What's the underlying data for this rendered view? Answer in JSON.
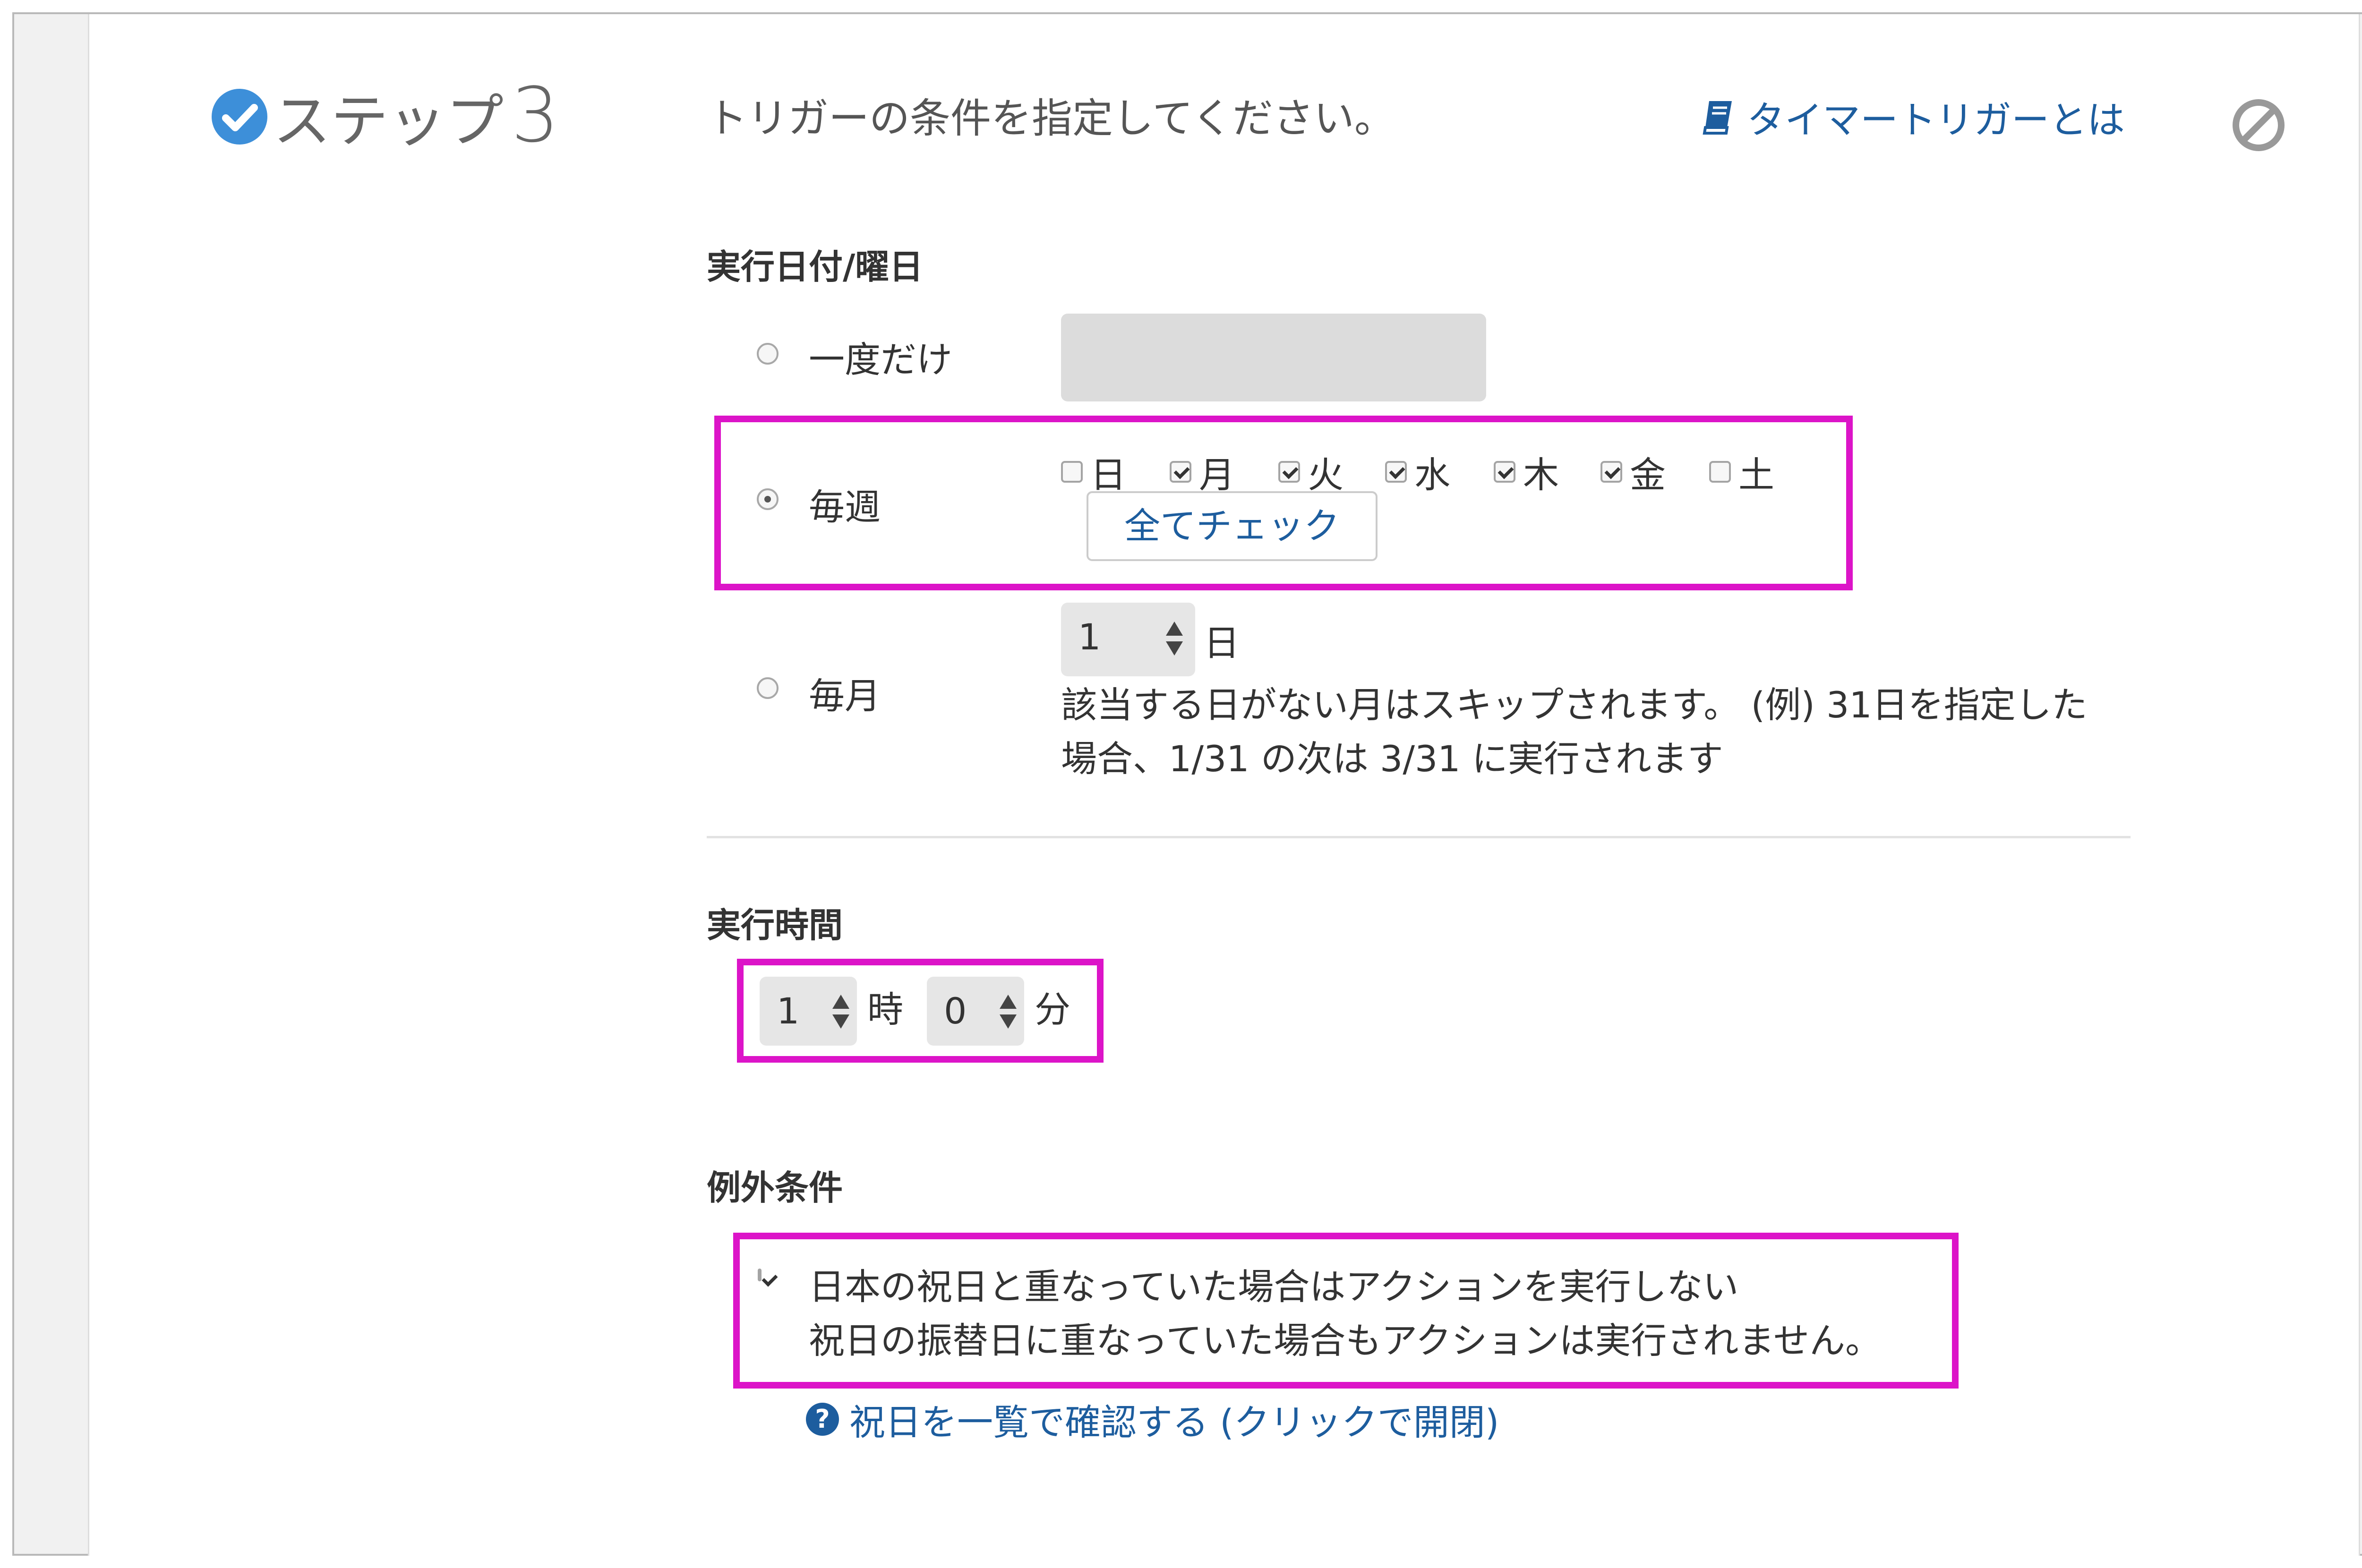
{
  "header": {
    "step_label": "ステップ",
    "step_number": "3",
    "instruction": "トリガーの条件を指定してください。",
    "help_link": "タイマートリガーとは",
    "icons": {
      "step_status": "check-circle-icon",
      "help": "book-icon",
      "disable": "disable-icon"
    }
  },
  "schedule": {
    "title": "実行日付/曜日",
    "once_label": "一度だけ",
    "weekly_label": "毎週",
    "monthly_label": "毎月",
    "selected": "毎週",
    "days": [
      {
        "label": "日",
        "checked": false
      },
      {
        "label": "月",
        "checked": true
      },
      {
        "label": "火",
        "checked": true
      },
      {
        "label": "水",
        "checked": true
      },
      {
        "label": "木",
        "checked": true
      },
      {
        "label": "金",
        "checked": true
      },
      {
        "label": "土",
        "checked": false
      }
    ],
    "check_all_button": "全てチェック",
    "monthly_day_value": "1",
    "monthly_day_unit": "日",
    "monthly_note_line1": "該当する日がない月はスキップされます。 (例) 31日を指定した",
    "monthly_note_line2": "場合、1/31 の次は 3/31 に実行されます"
  },
  "time": {
    "title": "実行時間",
    "hour_value": "1",
    "hour_unit": "時",
    "minute_value": "0",
    "minute_unit": "分"
  },
  "exception": {
    "title": "例外条件",
    "checked": true,
    "line1": "日本の祝日と重なっていた場合はアクションを実行しない",
    "line2": "祝日の振替日に重なっていた場合もアクションは実行されません。",
    "holiday_link": "祝日を一覧で確認する (クリックで開閉)"
  },
  "colors": {
    "highlight": "#dc14c8",
    "link": "#1d5d9e",
    "check_accent": "#3d8fd9"
  }
}
